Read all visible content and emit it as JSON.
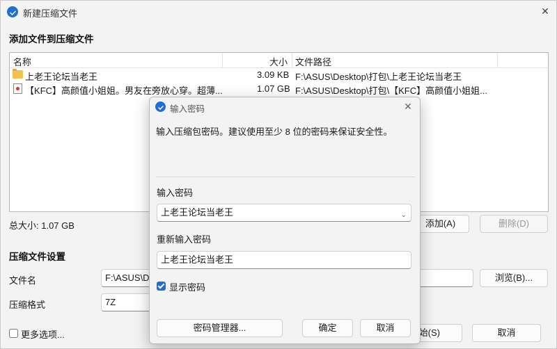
{
  "window": {
    "title": "新建压缩文件",
    "close_icon": "close-icon"
  },
  "add_files_section": {
    "title": "添加文件到压缩文件"
  },
  "file_list": {
    "columns": [
      "名称",
      "大小",
      "文件路径"
    ],
    "rows": [
      {
        "icon": "folder-icon",
        "name": "上老王论坛当老王",
        "size": "3.09 KB",
        "path": "F:\\ASUS\\Desktop\\打包\\上老王论坛当老王"
      },
      {
        "icon": "video-file-icon",
        "name": "【KFC】高颜值小姐姐。男友在旁放心穿。超薄...",
        "size": "1.07 GB",
        "path": "F:\\ASUS\\Desktop\\打包\\【KFC】高颜值小姐姐..."
      }
    ]
  },
  "total_size": "总大小: 1.07 GB",
  "buttons": {
    "add": "添加(A)",
    "delete": "删除(D)",
    "browse": "浏览(B)...",
    "start": "开始(S)",
    "start_visible": "始(S)",
    "cancel": "取消"
  },
  "settings": {
    "title": "压缩文件设置",
    "filename_label": "文件名",
    "filename_value": "F:\\ASUS\\De",
    "format_label": "压缩格式",
    "format_value": "7Z"
  },
  "more_options": {
    "label": "更多选项...",
    "checked": false
  },
  "dialog": {
    "title": "输入密码",
    "info": "输入压缩包密码。建议使用至少 8 位的密码来保证安全性。",
    "password_label": "输入密码",
    "password_value": "上老王论坛当老王",
    "reenter_label": "重新输入密码",
    "reenter_value": "上老王论坛当老王",
    "show_password": {
      "label": "显示密码",
      "checked": true
    },
    "manager_button": "密码管理器...",
    "ok_button": "确定",
    "cancel_button": "取消"
  },
  "colors": {
    "accent": "#1f6fd1",
    "folder": "#f2c14e",
    "window_bg": "#f3f3f3"
  }
}
